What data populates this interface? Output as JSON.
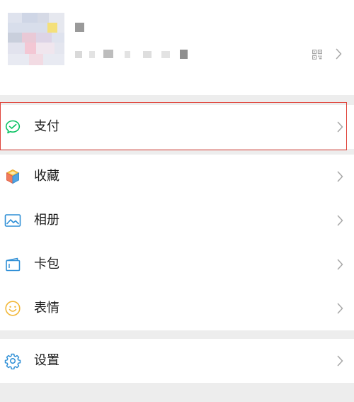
{
  "profile": {
    "qr_icon": "qr-code-icon",
    "chevron_icon": "chevron-right-icon"
  },
  "menu": {
    "pay": {
      "label": "支付",
      "icon": "wechat-pay-icon"
    },
    "favorites": {
      "label": "收藏",
      "icon": "cube-icon"
    },
    "album": {
      "label": "相册",
      "icon": "photo-album-icon"
    },
    "cards": {
      "label": "卡包",
      "icon": "wallet-card-icon"
    },
    "stickers": {
      "label": "表情",
      "icon": "smiley-face-icon"
    },
    "settings": {
      "label": "设置",
      "icon": "gear-icon"
    }
  },
  "colors": {
    "background": "#ededed",
    "surface": "#ffffff",
    "highlight_border": "#e0433a",
    "pay_green": "#07c160",
    "icon_blue": "#2f8fd6"
  }
}
